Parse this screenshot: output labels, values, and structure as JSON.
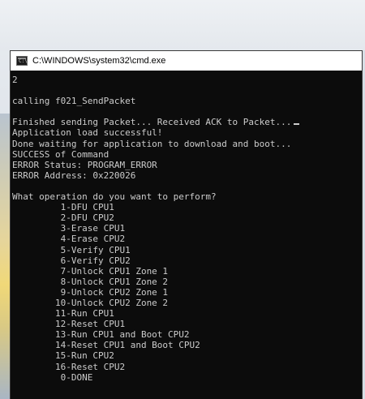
{
  "window": {
    "title": "C:\\WINDOWS\\system32\\cmd.exe",
    "icon": "cmd-console-icon",
    "icon_text": "C:\\"
  },
  "console": {
    "lines": [
      "2",
      "",
      "calling f021_SendPacket",
      "",
      "Finished sending Packet... Received ACK to Packet...",
      "Application load successful!",
      "Done waiting for application to download and boot...",
      "SUCCESS of Command",
      "ERROR Status: PROGRAM_ERROR",
      "ERROR Address: 0x220026",
      "",
      "What operation do you want to perform?",
      "         1-DFU CPU1",
      "         2-DFU CPU2",
      "         3-Erase CPU1",
      "         4-Erase CPU2",
      "         5-Verify CPU1",
      "         6-Verify CPU2",
      "         7-Unlock CPU1 Zone 1",
      "         8-Unlock CPU1 Zone 2",
      "         9-Unlock CPU2 Zone 1",
      "        10-Unlock CPU2 Zone 2",
      "        11-Run CPU1",
      "        12-Reset CPU1",
      "        13-Run CPU1 and Boot CPU2",
      "        14-Reset CPU1 and Boot CPU2",
      "        15-Run CPU2",
      "        16-Reset CPU2",
      "         0-DONE"
    ],
    "cursor_line_index": 4
  },
  "colors": {
    "console_background": "#0c0c0c",
    "console_text": "#cccccc",
    "titlebar_background": "#ffffff"
  }
}
